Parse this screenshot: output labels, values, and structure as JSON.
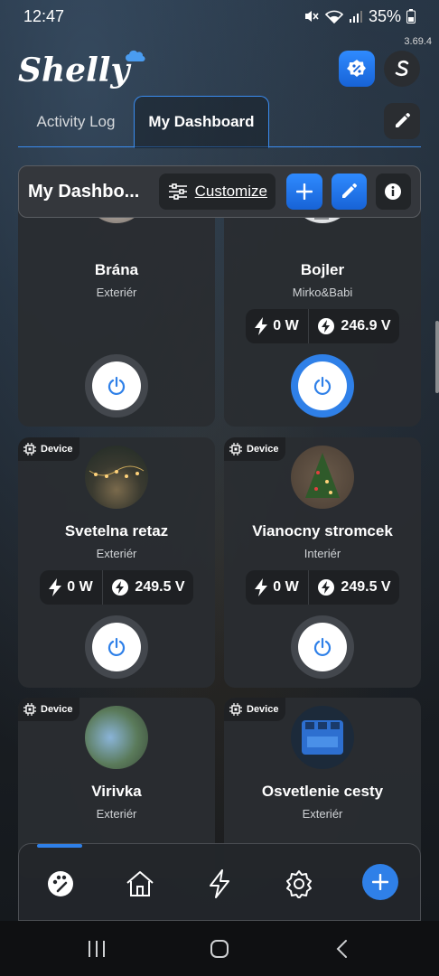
{
  "status_bar": {
    "time": "12:47",
    "battery": "35%"
  },
  "app": {
    "name": "Shelly",
    "version": "3.69.4"
  },
  "tabs": [
    {
      "label": "Activity Log",
      "active": false
    },
    {
      "label": "My Dashboard",
      "active": true
    }
  ],
  "toolbar": {
    "title": "My Dashbo...",
    "customize_label": "Customize"
  },
  "cards": [
    {
      "name": "Brána",
      "room": "Exteriér",
      "badge": "",
      "power_on": false,
      "show_meters": false
    },
    {
      "name": "Bojler",
      "room": "Mirko&Babi",
      "badge": "",
      "power": "0 W",
      "voltage": "246.9 V",
      "power_on": true,
      "show_meters": true
    },
    {
      "name": "Svetelna retaz",
      "room": "Exteriér",
      "badge": "Device",
      "power": "0 W",
      "voltage": "249.5 V",
      "power_on": false,
      "show_meters": true
    },
    {
      "name": "Vianocny stromcek",
      "room": "Interiér",
      "badge": "Device",
      "power": "0 W",
      "voltage": "249.5 V",
      "power_on": false,
      "show_meters": true
    },
    {
      "name": "Virivka",
      "room": "Exteriér",
      "badge": "Device",
      "power_on": false,
      "show_meters": false
    },
    {
      "name": "Osvetlenie cesty",
      "room": "Exteriér",
      "badge": "Device",
      "power_on": false,
      "show_meters": false
    }
  ],
  "bottom_nav": [
    {
      "icon": "dashboard-icon",
      "active": true
    },
    {
      "icon": "home-icon",
      "active": false
    },
    {
      "icon": "energy-icon",
      "active": false
    },
    {
      "icon": "settings-icon",
      "active": false
    },
    {
      "icon": "add-icon",
      "active": false
    }
  ],
  "colors": {
    "accent": "#2f80e8",
    "card": "#2a2d31",
    "badge": "#1f2124"
  }
}
